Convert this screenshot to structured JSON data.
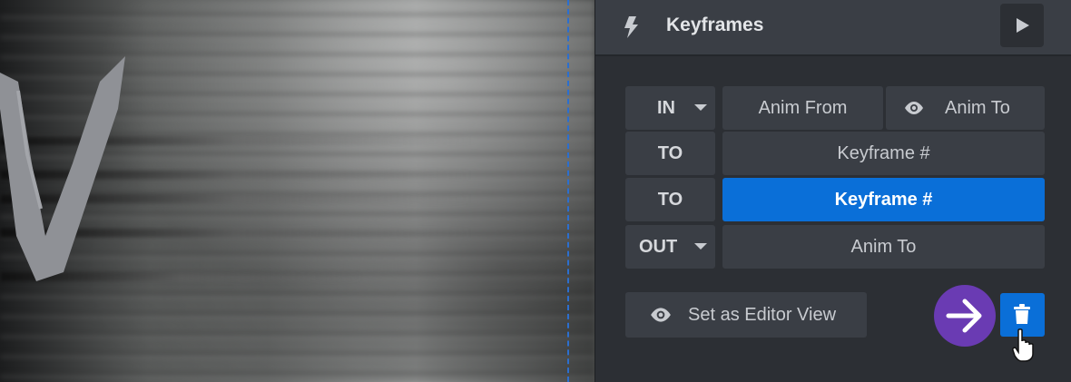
{
  "panel": {
    "title": "Keyframes"
  },
  "rows": [
    {
      "label": "IN",
      "has_dropdown": true,
      "cells": [
        {
          "text": "Anim From"
        },
        {
          "text": "Anim To",
          "icon": "eye-icon"
        }
      ]
    },
    {
      "label": "TO",
      "has_dropdown": false,
      "cells": [
        {
          "text": "Keyframe #"
        }
      ]
    },
    {
      "label": "TO",
      "has_dropdown": false,
      "cells": [
        {
          "text": "Keyframe #",
          "selected": true
        }
      ]
    },
    {
      "label": "OUT",
      "has_dropdown": true,
      "cells": [
        {
          "text": "Anim To"
        }
      ]
    }
  ],
  "footer": {
    "editor_view_label": "Set as Editor View"
  },
  "colors": {
    "accent_blue": "#0a6fd8",
    "highlight_purple": "#6a3bb3",
    "panel_bg": "#2c2f34",
    "cell_bg": "#3a3e45"
  }
}
